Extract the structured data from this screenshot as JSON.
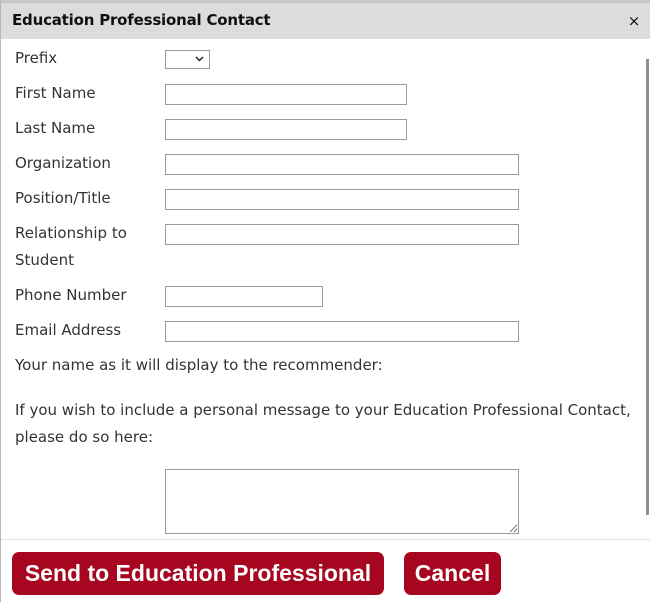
{
  "dialog": {
    "title": "Education Professional Contact",
    "close_icon": "×"
  },
  "form": {
    "fields": [
      {
        "label": "Prefix",
        "type": "select",
        "value": ""
      },
      {
        "label": "First Name",
        "type": "text",
        "value": ""
      },
      {
        "label": "Last Name",
        "type": "text",
        "value": ""
      },
      {
        "label": "Organization",
        "type": "text",
        "value": ""
      },
      {
        "label": "Position/Title",
        "type": "text",
        "value": ""
      },
      {
        "label": "Relationship to Student",
        "label_line1": "Relationship to",
        "label_line2": "Student",
        "type": "text",
        "value": ""
      },
      {
        "label": "Phone Number",
        "type": "text",
        "value": ""
      },
      {
        "label": "Email Address",
        "type": "text",
        "value": ""
      }
    ],
    "select_chevron": "⌄",
    "display_name_text": "Your name as it will display to the recommender:",
    "message_prompt_line1": "If you wish to include a personal message to your Education Professional Contact,",
    "message_prompt_line2": "please do so here:",
    "message_value": ""
  },
  "footer": {
    "send_label": "Send to Education Professional",
    "cancel_label": "Cancel"
  },
  "colors": {
    "button_bg": "#a6061f",
    "titlebar_bg": "#dcdcdc"
  }
}
